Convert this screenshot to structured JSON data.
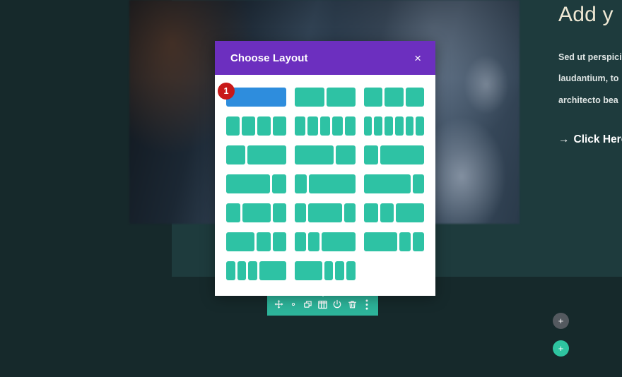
{
  "theme": {
    "page_bg": "#16292b",
    "row_bg": "#1e3b3d",
    "modal_header_bg": "#6c2fbf",
    "accent_teal": "#2ec2a4",
    "selected_blue": "#2e8ddd",
    "badge_red": "#c91919",
    "toolbar_bg": "#2db49a",
    "heading_color": "#efe8d4"
  },
  "content": {
    "headline": "Add y",
    "paragraph_lines": [
      "Sed ut perspici",
      "laudantium, to",
      "architecto bea"
    ],
    "cta_arrow": "→",
    "cta_label": "Click Here"
  },
  "add_buttons": {
    "gray_label": "+",
    "teal_label": "+"
  },
  "toolbar": {
    "items": [
      {
        "name": "move-icon",
        "label": "Move"
      },
      {
        "name": "gear-icon",
        "label": "Settings"
      },
      {
        "name": "duplicate-icon",
        "label": "Duplicate"
      },
      {
        "name": "columns-icon",
        "label": "Choose Layout"
      },
      {
        "name": "power-icon",
        "label": "Disable"
      },
      {
        "name": "trash-icon",
        "label": "Delete"
      },
      {
        "name": "more-vertical-icon",
        "label": "More Options"
      }
    ]
  },
  "modal": {
    "title": "Choose Layout",
    "close_label": "×",
    "selected_index": 0,
    "selected_badge": "1",
    "layouts": [
      {
        "name": "1-column",
        "cols": [
          1
        ]
      },
      {
        "name": "2-column",
        "cols": [
          1,
          1
        ]
      },
      {
        "name": "3-column",
        "cols": [
          1,
          1,
          1
        ]
      },
      {
        "name": "4-column",
        "cols": [
          1,
          1,
          1,
          1
        ]
      },
      {
        "name": "5-column",
        "cols": [
          1,
          1,
          1,
          1,
          1
        ]
      },
      {
        "name": "6-column",
        "cols": [
          1,
          1,
          1,
          1,
          1,
          1
        ]
      },
      {
        "name": "1-3-2-3",
        "cols": [
          1,
          2
        ]
      },
      {
        "name": "2-3-1-3",
        "cols": [
          2,
          1
        ]
      },
      {
        "name": "1-4-3-4",
        "cols": [
          1,
          3
        ]
      },
      {
        "name": "3-4-1-4",
        "cols": [
          3,
          1
        ]
      },
      {
        "name": "1-5-4-5",
        "cols": [
          1,
          4
        ]
      },
      {
        "name": "4-5-1-5",
        "cols": [
          4,
          1
        ]
      },
      {
        "name": "1-4-1-2-1-4",
        "cols": [
          1,
          2,
          1
        ]
      },
      {
        "name": "1-5-3-5-1-5",
        "cols": [
          1,
          3,
          1
        ]
      },
      {
        "name": "1-4-1-4-1-2",
        "cols": [
          1,
          1,
          2
        ]
      },
      {
        "name": "1-2-1-4-1-4",
        "cols": [
          2,
          1,
          1
        ]
      },
      {
        "name": "1-5-1-5-3-5",
        "cols": [
          1,
          1,
          3
        ]
      },
      {
        "name": "3-5-1-5-1-5",
        "cols": [
          3,
          1,
          1
        ]
      },
      {
        "name": "1-6-1-6-1-6-1-2",
        "cols": [
          1,
          1,
          1,
          3
        ]
      },
      {
        "name": "1-2-1-6-1-6-1-6",
        "cols": [
          3,
          1,
          1,
          1
        ]
      },
      {
        "name": "blank",
        "cols": []
      }
    ]
  }
}
